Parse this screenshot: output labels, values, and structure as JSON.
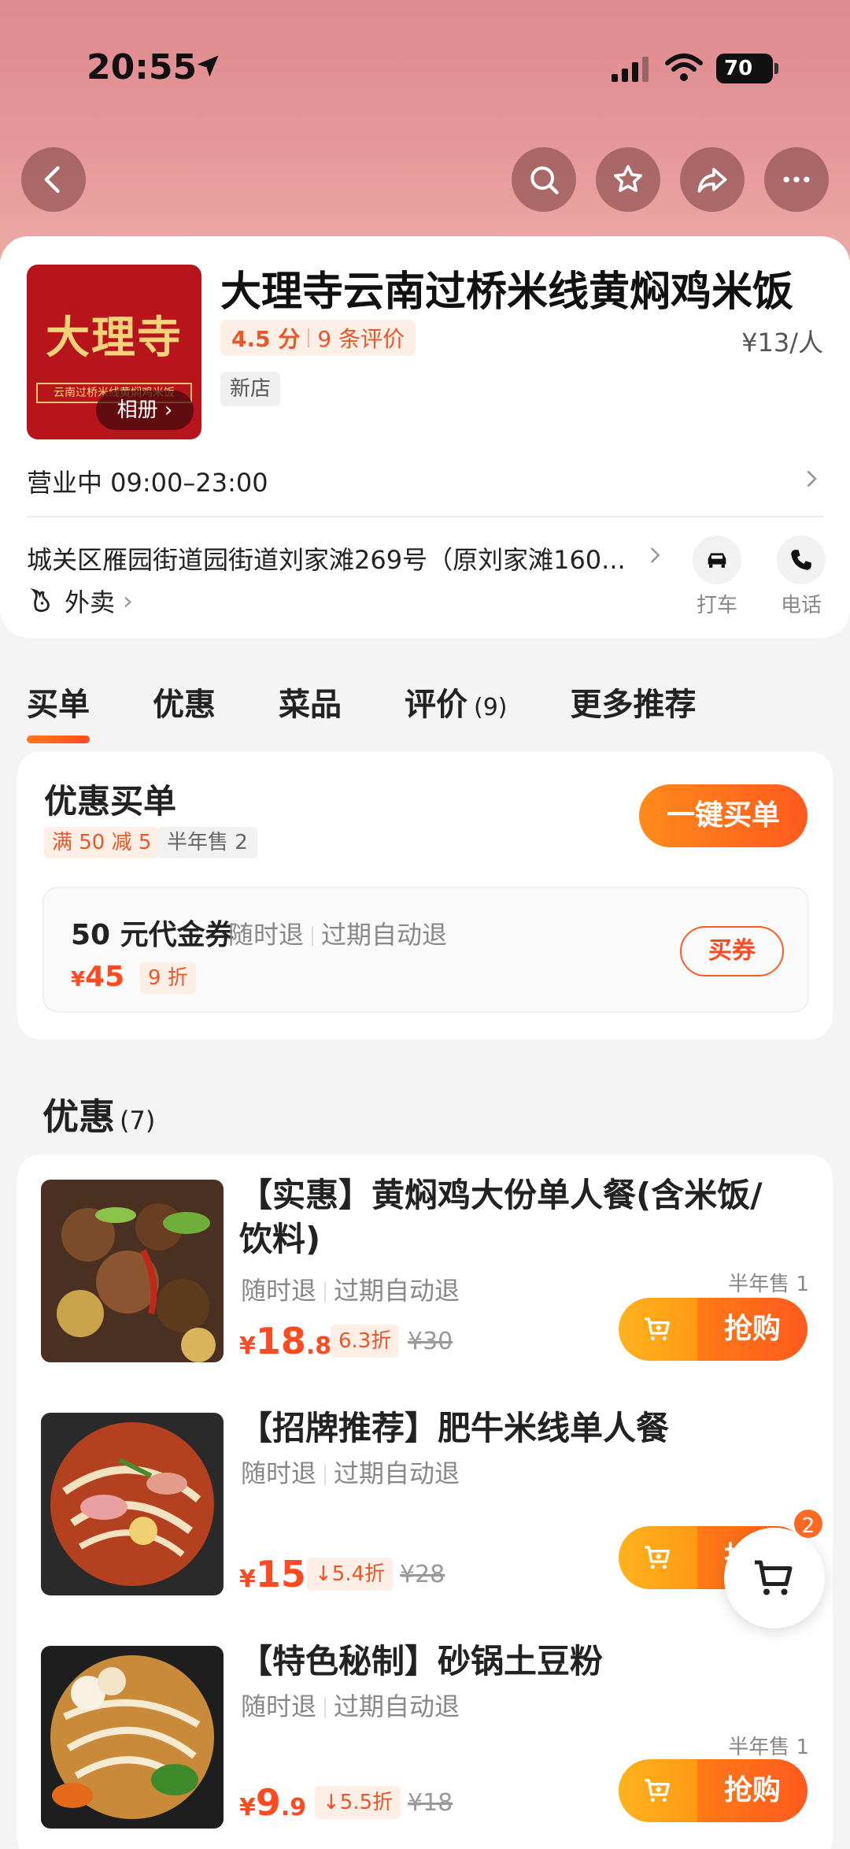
{
  "status_bar": {
    "time": "20:55",
    "battery": "70"
  },
  "colors": {
    "accent": "#ff5a1e",
    "header": "#e2908f",
    "price": "#ff4a22"
  },
  "store": {
    "name": "大理寺云南过桥米线黄焖鸡米饭",
    "logo_text": "大理寺",
    "logo_subtext": "云南过桥米线黄焖鸡米饭",
    "album_label": "相册",
    "rating_score": "4.5 分",
    "review_count": "9 条评价",
    "price_per_person": "¥13/人",
    "new_tag": "新店",
    "hours": "营业中 09:00–23:00",
    "address": "城关区雁园街道园街道刘家滩269号（原刘家滩160...",
    "delivery_label": "外卖",
    "taxi_label": "打车",
    "phone_label": "电话"
  },
  "tabs": [
    {
      "label": "买单"
    },
    {
      "label": "优惠"
    },
    {
      "label": "菜品"
    },
    {
      "label": "评价",
      "count": "(9)"
    },
    {
      "label": "更多推荐"
    }
  ],
  "pay": {
    "title": "优惠买单",
    "tag_offer": "满 50 减 5",
    "tag_sold": "半年售 2",
    "button": "一键买单",
    "voucher": {
      "name": "50 元代金券",
      "refund_any": "随时退",
      "refund_expire": "过期自动退",
      "price_symbol": "¥",
      "price": "45",
      "discount": "9 折",
      "button": "买券"
    }
  },
  "deals_section": {
    "title": "优惠",
    "count": "(7)"
  },
  "deals": [
    {
      "name": "【实惠】黄焖鸡大份单人餐(含米饭/饮料)",
      "refund_any": "随时退",
      "refund_expire": "过期自动退",
      "sold": "半年售 1",
      "price_symbol": "¥",
      "price_int": "18",
      "price_dec": ".8",
      "discount": "6.3折",
      "original": "¥30",
      "button": "抢购"
    },
    {
      "name": "【招牌推荐】肥牛米线单人餐",
      "refund_any": "随时退",
      "refund_expire": "过期自动退",
      "price_symbol": "¥",
      "price_int": "15",
      "price_dec": "",
      "discount": "5.4折",
      "original": "¥28",
      "button": "抢购"
    },
    {
      "name": "【特色秘制】砂锅土豆粉",
      "refund_any": "随时退",
      "refund_expire": "过期自动退",
      "sold": "半年售 1",
      "price_symbol": "¥",
      "price_int": "9",
      "price_dec": ".9",
      "discount": "5.5折",
      "original": "¥18",
      "button": "抢购"
    }
  ],
  "cart": {
    "badge": "2"
  }
}
